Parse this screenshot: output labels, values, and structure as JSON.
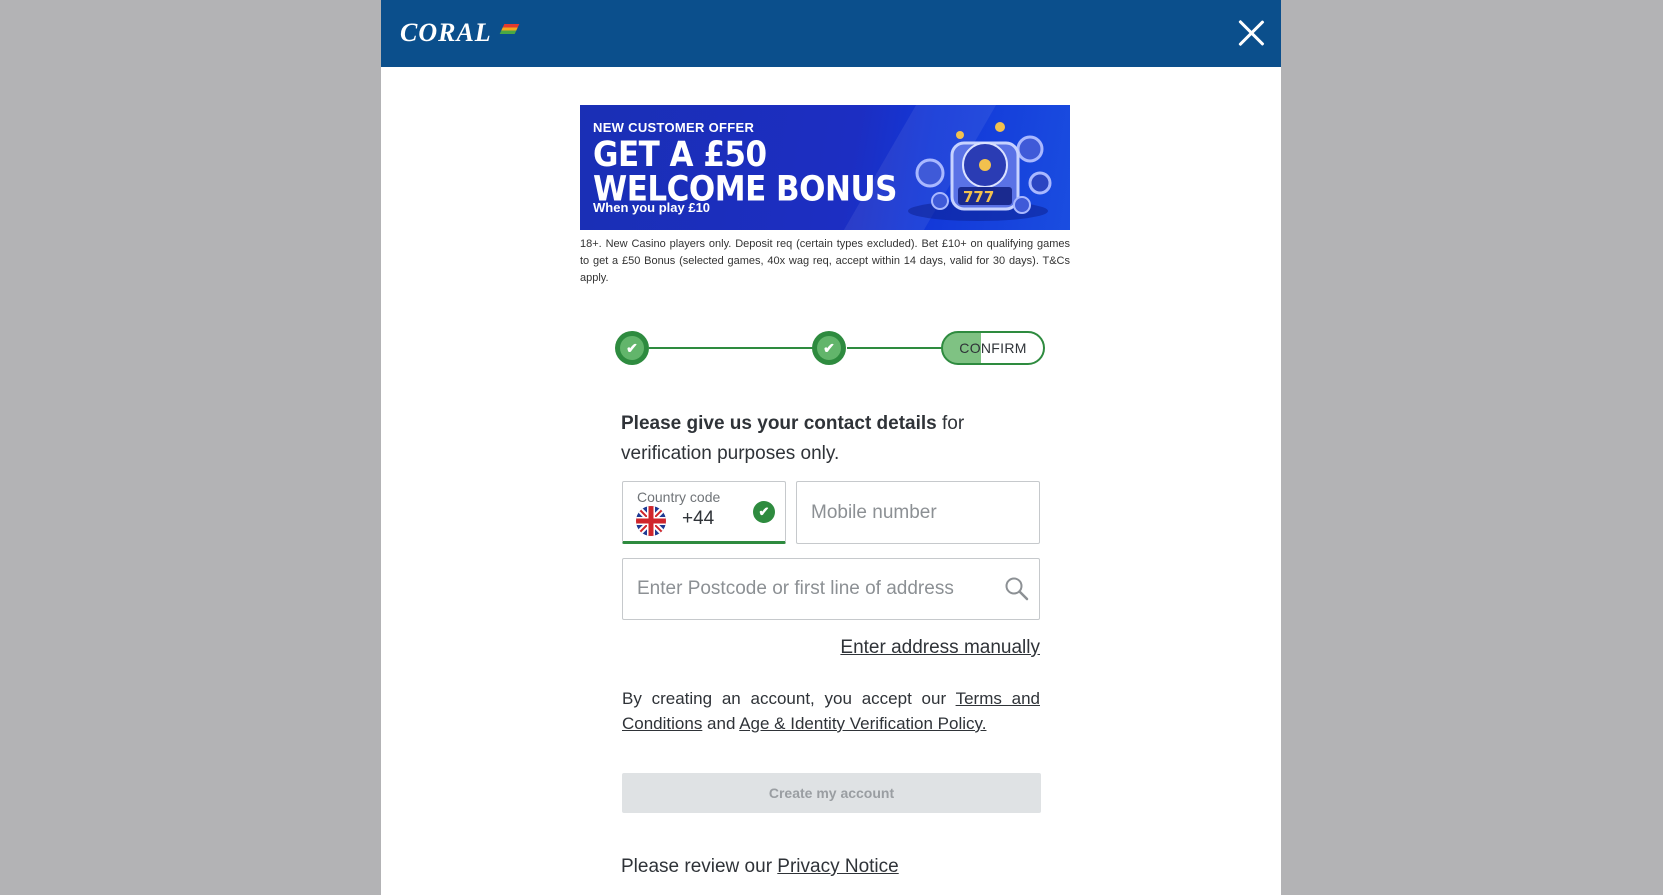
{
  "header": {
    "logo_text": "CORAL",
    "close_label": "×"
  },
  "banner": {
    "eyebrow": "NEW CUSTOMER OFFER",
    "headline_line1": "GET A £50",
    "headline_line2": "WELCOME BONUS",
    "subline": "When you play £10"
  },
  "disclaimer": "18+. New Casino players only. Deposit req (certain types excluded). Bet £10+ on qualifying games to get a £50 Bonus (selected games, 40x wag req, accept within 14 days, valid for 30 days). T&Cs apply.",
  "stepper": {
    "step1_mark": "✔",
    "step2_mark": "✔",
    "step3_label": "CONFIRM",
    "progress": 0.66
  },
  "intro": {
    "bold": "Please give us your contact details",
    "rest": " for verification purposes only."
  },
  "country_code": {
    "label": "Country code",
    "value": "+44",
    "check_mark": "✔"
  },
  "mobile": {
    "placeholder": "Mobile number"
  },
  "address": {
    "placeholder": "Enter Postcode or first line of address"
  },
  "manual_link": "Enter address manually",
  "terms": {
    "prefix": "By creating an account, you accept our ",
    "terms_link": "Terms and Conditions",
    "middle": " and ",
    "policy_link": "Age & Identity Verification Policy."
  },
  "create_button": "Create my account",
  "privacy": {
    "prefix": "Please review our ",
    "link": "Privacy Notice"
  },
  "colors": {
    "brand_blue": "#0b4f8c",
    "success_green": "#2e8b3f",
    "disabled_button": "#dfe2e4"
  }
}
